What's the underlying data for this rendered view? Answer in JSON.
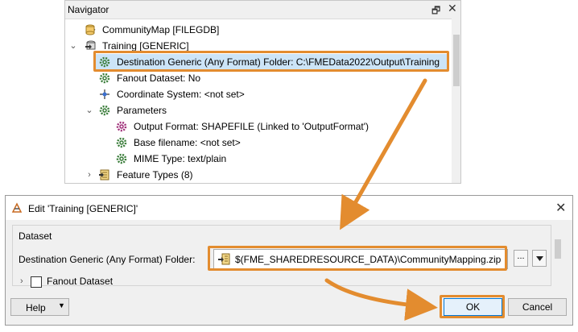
{
  "navigator": {
    "title": "Navigator",
    "restore_glyph": "🗗",
    "close_glyph": "✕",
    "items": [
      {
        "label": "CommunityMap [FILEGDB]",
        "icon": "database-icon",
        "expander": "›"
      },
      {
        "label": "Training [GENERIC]",
        "icon": "writer-icon",
        "expander": "⌄"
      },
      {
        "label": "Destination Generic (Any Format) Folder: C:\\FMEData2022\\Output\\Training",
        "icon": "gear-icon"
      },
      {
        "label": "Fanout Dataset: No",
        "icon": "gear-icon"
      },
      {
        "label": "Coordinate System: <not set>",
        "icon": "coordinate-icon"
      },
      {
        "label": "Parameters",
        "icon": "gear-icon",
        "expander": "⌄"
      },
      {
        "label": "Output Format: SHAPEFILE (Linked to 'OutputFormat')",
        "icon": "linked-gear-icon"
      },
      {
        "label": "Base filename: <not set>",
        "icon": "gear-icon"
      },
      {
        "label": "MIME Type: text/plain",
        "icon": "gear-icon"
      },
      {
        "label": "Feature Types (8)",
        "icon": "feature-types-icon",
        "expander": "›"
      }
    ]
  },
  "dialog": {
    "title": "Edit 'Training [GENERIC]'",
    "close_glyph": "✕",
    "group_label": "Dataset",
    "field_label": "Destination Generic (Any Format) Folder:",
    "field_value": "$(FME_SHAREDRESOURCE_DATA)\\CommunityMapping.zip",
    "browse_label": "...",
    "fanout_expander": "›",
    "fanout_label": "Fanout Dataset",
    "help_label": "Help",
    "help_dropdown": "▼",
    "ok_label": "OK",
    "cancel_label": "Cancel"
  },
  "colors": {
    "highlight": "#e38c2f",
    "selection": "#cce4f7",
    "accent": "#0078d7"
  }
}
